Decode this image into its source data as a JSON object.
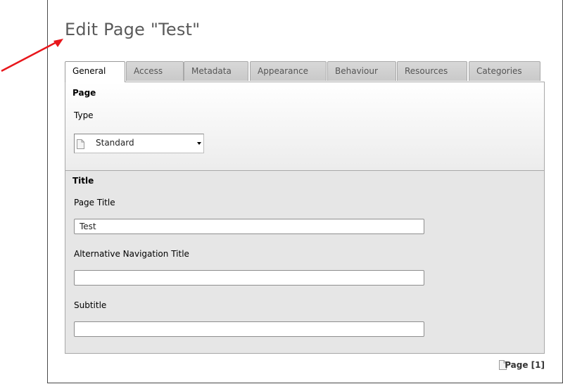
{
  "page": {
    "title": "Edit Page \"Test\""
  },
  "tabs": [
    {
      "label": "General",
      "active": true
    },
    {
      "label": "Access"
    },
    {
      "label": "Metadata"
    },
    {
      "label": "Appearance"
    },
    {
      "label": "Behaviour"
    },
    {
      "label": "Resources"
    },
    {
      "label": "Categories"
    }
  ],
  "sections": {
    "page": {
      "title": "Page",
      "type_label": "Type",
      "type_value": "Standard"
    },
    "title": {
      "title": "Title",
      "page_title_label": "Page Title",
      "page_title_value": "Test",
      "alt_nav_label": "Alternative Navigation Title",
      "alt_nav_value": "",
      "subtitle_label": "Subtitle",
      "subtitle_value": ""
    }
  },
  "footer": {
    "link": "Page [1]"
  },
  "colors": {
    "arrow": "#e8161b",
    "title": "#5a5a5a",
    "panel": "#e6e6e6"
  },
  "icons": [
    "red-arrow-annotation",
    "document-icon",
    "dropdown-arrow-icon"
  ]
}
